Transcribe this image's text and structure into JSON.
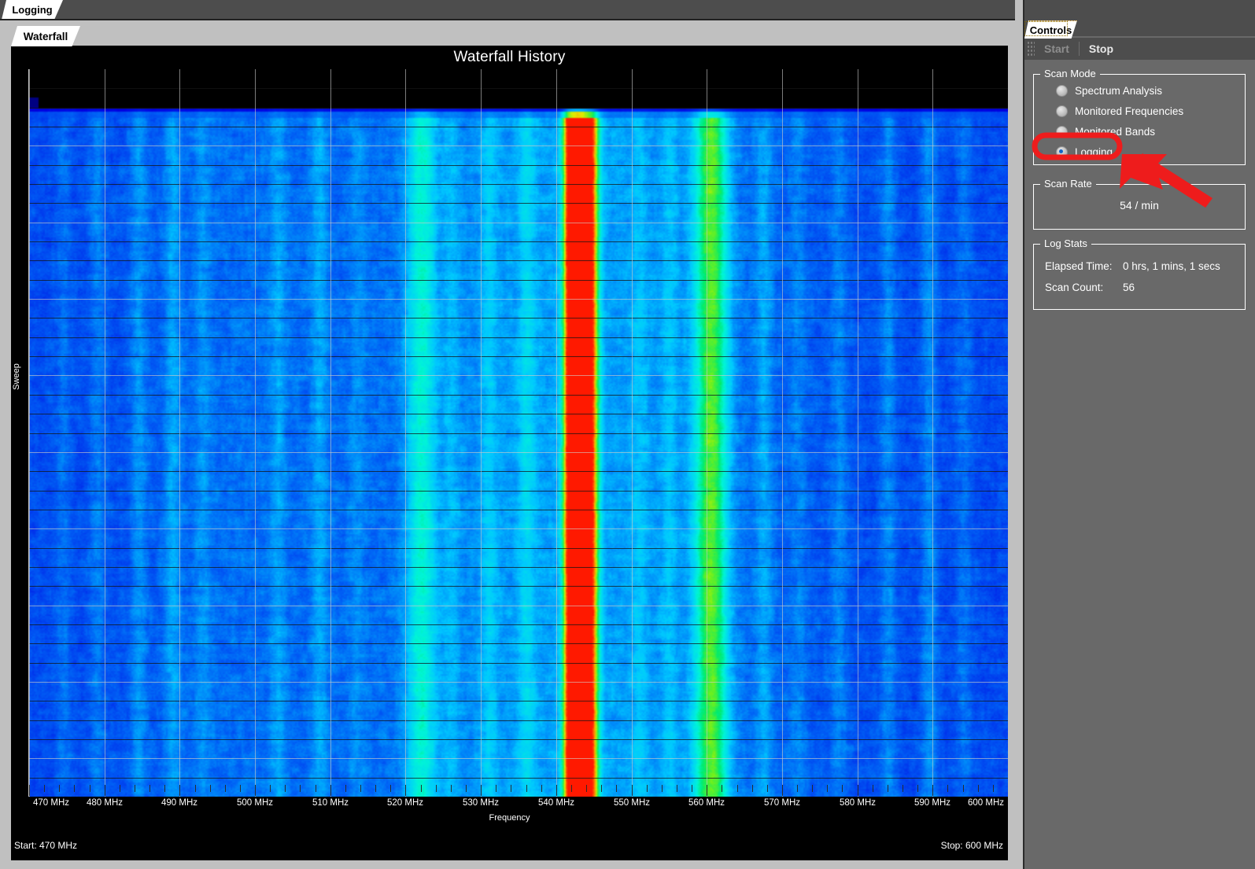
{
  "window": {
    "outer_tab": "Logging",
    "inner_tab": "Waterfall"
  },
  "plot": {
    "title": "Waterfall History",
    "ylabel": "Sweep",
    "xlabel": "Frequency",
    "start_freq_text": "Start: 470 MHz",
    "stop_freq_text": "Stop: 600 MHz"
  },
  "controls": {
    "tab_label": "Controls",
    "toolbar": {
      "start_label": "Start",
      "start_enabled": false,
      "stop_label": "Stop",
      "stop_enabled": true
    },
    "scan_mode": {
      "legend": "Scan Mode",
      "options": [
        {
          "label": "Spectrum Analysis",
          "selected": false
        },
        {
          "label": "Monitored Frequencies",
          "selected": false
        },
        {
          "label": "Monitored Bands",
          "selected": false
        },
        {
          "label": "Logging",
          "selected": true
        }
      ]
    },
    "scan_rate": {
      "legend": "Scan Rate",
      "value": "54 / min"
    },
    "log_stats": {
      "legend": "Log Stats",
      "elapsed_label": "Elapsed Time:",
      "elapsed_value": "0 hrs, 1 mins, 1 secs",
      "count_label": "Scan Count:",
      "count_value": "56"
    }
  },
  "annotation": {
    "highlight_color": "#ee1c1c",
    "highlight_target": "Logging"
  },
  "chart_data": {
    "type": "heatmap",
    "title": "Waterfall History",
    "xlabel": "Frequency",
    "ylabel": "Sweep",
    "xlim": [
      470,
      600
    ],
    "x_unit": "MHz",
    "xtick_labels": [
      "470 MHz",
      "480 MHz",
      "490 MHz",
      "500 MHz",
      "510 MHz",
      "520 MHz",
      "530 MHz",
      "540 MHz",
      "550 MHz",
      "560 MHz",
      "570 MHz",
      "580 MHz",
      "590 MHz",
      "600 MHz"
    ],
    "xticks": [
      470,
      480,
      490,
      500,
      510,
      520,
      530,
      540,
      550,
      560,
      570,
      580,
      590,
      600
    ],
    "minor_tick_step_mhz": 2,
    "grid": true,
    "legend": "none",
    "colormap": [
      "#000080",
      "#0000ff",
      "#0080ff",
      "#00d0ff",
      "#00ffc0",
      "#00ff40",
      "#80ff00",
      "#ffff00",
      "#ff8000",
      "#ff0000"
    ],
    "sweep_rows": 38,
    "peaks": [
      {
        "center_mhz": 543.0,
        "level": "max",
        "color": "#ff0000",
        "width_mhz": 1.2
      },
      {
        "center_mhz": 541.6,
        "level": "high",
        "color": "#00e000",
        "width_mhz": 0.9
      },
      {
        "center_mhz": 544.6,
        "level": "high",
        "color": "#00e000",
        "width_mhz": 1.0
      },
      {
        "center_mhz": 560.5,
        "level": "medium",
        "color": "#00ffa0",
        "width_mhz": 2.2
      },
      {
        "center_mhz": 522.0,
        "level": "low-medium",
        "color": "#00d8d0",
        "width_mhz": 2.0
      }
    ],
    "noise_floor_color": "#0a3ccc",
    "top_blank_rows": 2
  }
}
